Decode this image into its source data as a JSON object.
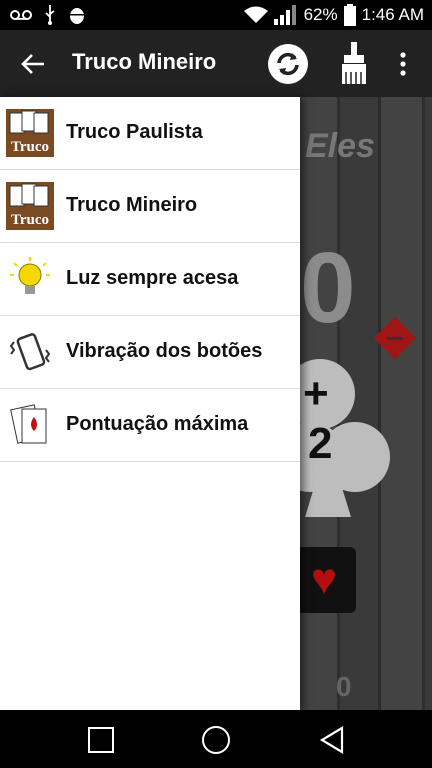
{
  "status_bar": {
    "battery": "62%",
    "time": "1:46 AM",
    "icons": [
      "voicemail-icon",
      "usb-icon",
      "android-debug-icon",
      "wifi-icon",
      "signal-icon",
      "battery-icon"
    ]
  },
  "app_bar": {
    "title": "Truco Mineiro",
    "icons": [
      "back-arrow-icon",
      "refresh-icon",
      "brush-icon",
      "overflow-menu-icon"
    ]
  },
  "background": {
    "team_label": "Eles",
    "score_big": "0",
    "plus_sign": "+",
    "plus_value": "2",
    "score_small": "0"
  },
  "drawer": {
    "items": [
      {
        "label": "Truco Paulista",
        "icon": "truco-cards-icon"
      },
      {
        "label": "Truco Mineiro",
        "icon": "truco-cards-icon"
      },
      {
        "label": "Luz sempre acesa",
        "icon": "light-bulb-icon"
      },
      {
        "label": "Vibração dos botões",
        "icon": "vibrating-phone-icon"
      },
      {
        "label": "Pontuação máxima",
        "icon": "playing-cards-icon"
      }
    ]
  },
  "colors": {
    "app_bar": "#222222",
    "drawer_bg": "#ffffff",
    "heart_red": "#b50e0e",
    "diamond_red": "#a01515"
  }
}
